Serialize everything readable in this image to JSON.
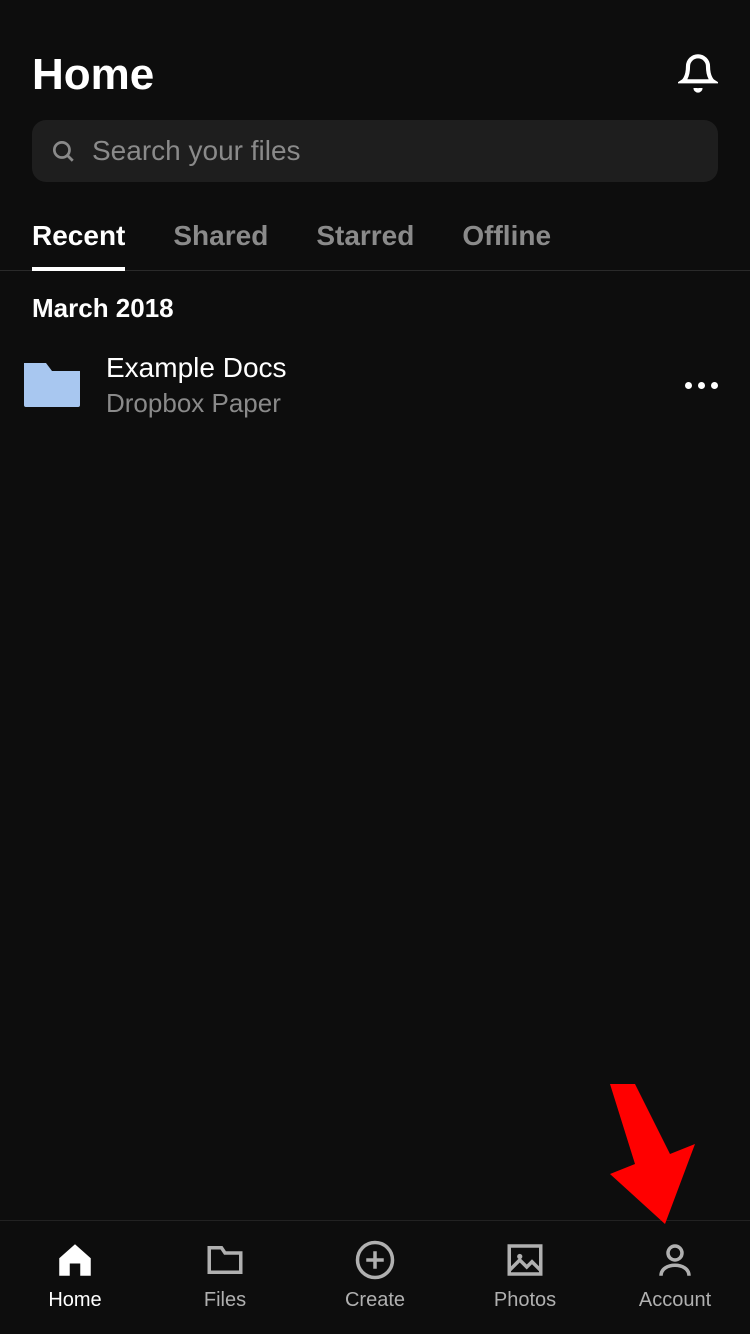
{
  "header": {
    "title": "Home"
  },
  "search": {
    "placeholder": "Search your files"
  },
  "tabs": [
    {
      "label": "Recent",
      "active": true
    },
    {
      "label": "Shared",
      "active": false
    },
    {
      "label": "Starred",
      "active": false
    },
    {
      "label": "Offline",
      "active": false
    }
  ],
  "section": {
    "header": "March 2018"
  },
  "items": [
    {
      "title": "Example Docs",
      "subtitle": "Dropbox Paper"
    }
  ],
  "nav": [
    {
      "label": "Home",
      "active": true
    },
    {
      "label": "Files",
      "active": false
    },
    {
      "label": "Create",
      "active": false
    },
    {
      "label": "Photos",
      "active": false
    },
    {
      "label": "Account",
      "active": false
    }
  ],
  "colors": {
    "folder": "#a8c7f0",
    "arrow": "#ff0000"
  }
}
